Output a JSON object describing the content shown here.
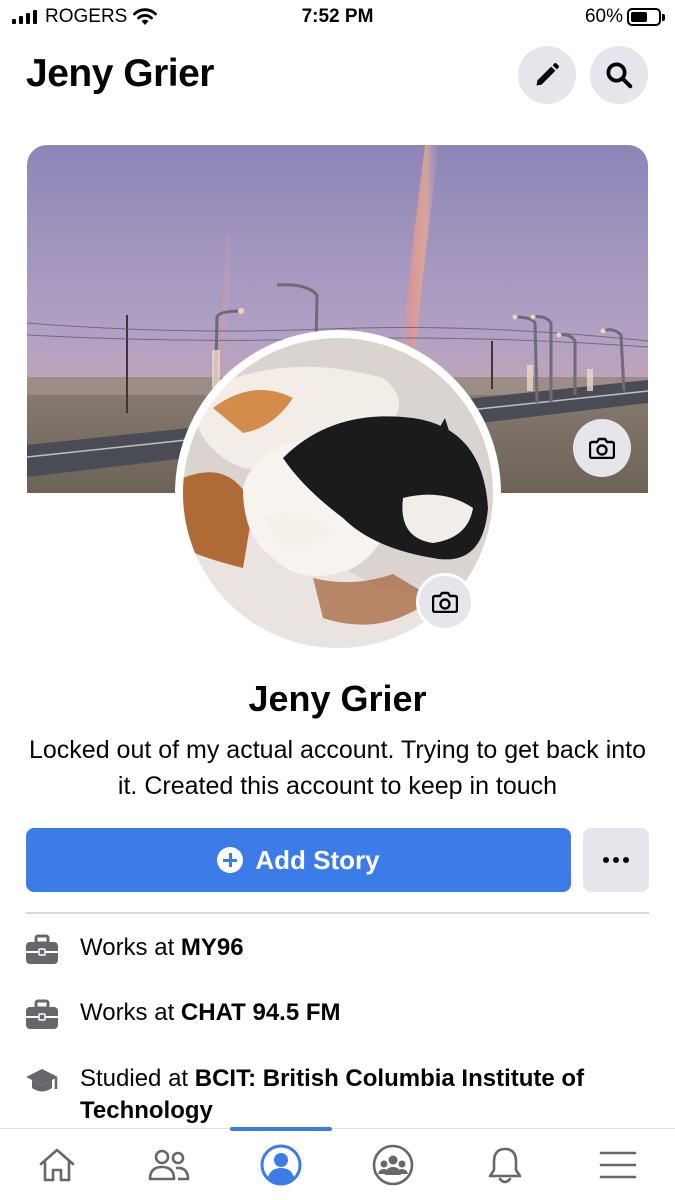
{
  "status_bar": {
    "carrier": "ROGERS",
    "time": "7:52 PM",
    "battery_percent": "60%",
    "battery_level": 0.6
  },
  "header": {
    "title": "Jeny Grier",
    "edit_icon": "pencil-icon",
    "search_icon": "search-icon"
  },
  "profile": {
    "name": "Jeny Grier",
    "bio": "Locked out of my actual account. Trying to get back into it. Created this account to keep in touch"
  },
  "actions": {
    "add_story_label": "Add Story",
    "more_icon": "ellipsis-icon"
  },
  "info": [
    {
      "prefix": "Works at ",
      "value": "MY96",
      "icon": "briefcase-icon"
    },
    {
      "prefix": "Works at ",
      "value": "CHAT 94.5 FM",
      "icon": "briefcase-icon"
    },
    {
      "prefix": "Studied at ",
      "value": "BCIT: British Columbia Institute of Technology",
      "icon": "graduation-cap-icon"
    }
  ],
  "tabbar": {
    "items": [
      "home-icon",
      "friends-icon",
      "profile-icon",
      "groups-icon",
      "notifications-icon",
      "menu-icon"
    ],
    "active": "profile-icon"
  },
  "colors": {
    "accent": "#3b7ce8",
    "button_gray": "#e4e6eb",
    "icon_gray": "#65676b"
  }
}
